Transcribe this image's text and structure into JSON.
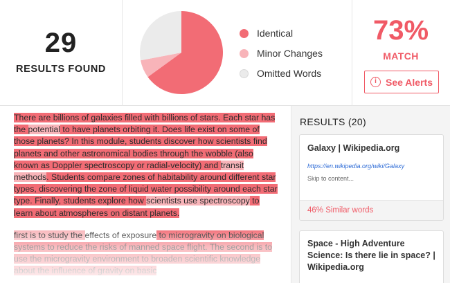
{
  "summary": {
    "results_count": "29",
    "results_label": "RESULTS FOUND",
    "match_percent": "73%",
    "match_label": "MATCH",
    "alerts_button": "See Alerts",
    "info_icon": "i"
  },
  "chart_data": {
    "type": "pie",
    "slices": [
      {
        "label": "Identical",
        "value": 65,
        "color": "#f26c75"
      },
      {
        "label": "Minor Changes",
        "value": 7,
        "color": "#f8b4b9"
      },
      {
        "label": "Omitted Words",
        "value": 28,
        "color": "#ebebeb"
      }
    ]
  },
  "legend": [
    {
      "label": "Identical",
      "color": "#f26c75"
    },
    {
      "label": "Minor Changes",
      "color": "#f8b4b9"
    },
    {
      "label": "Omitted Words",
      "color": "#ebebeb"
    }
  ],
  "document": {
    "paragraph1": [
      {
        "t": "There are billions of galaxies filled with billions of stars. Each star has the ",
        "h": "i"
      },
      {
        "t": "potential",
        "h": "m"
      },
      {
        "t": " to have planets orbiting it. Does life exist on some of those planets? In this module, students discover how scientists find planets and other astronomical bodies through the wobble (also known as Doppler spectroscopy or radial-velocity) and ",
        "h": "i"
      },
      {
        "t": "transit methods",
        "h": "m"
      },
      {
        "t": ". Students compare zones of habitability around different star types, discovering the zone of liquid water possibility around each star type. Finally, students explore how ",
        "h": "i"
      },
      {
        "t": "scientists use spectroscopy",
        "h": "m"
      },
      {
        "t": " to learn about atmospheres on distant planets.",
        "h": "i"
      }
    ],
    "paragraph2": [
      {
        "t": "first is to study the ",
        "h": "m"
      },
      {
        "t": "effects of exposure",
        "h": ""
      },
      {
        "t": " to microgravity on biological systems to reduce the risks of manned space flight. The second is to use the microgravity environment to broaden scientific knowledge about the influence of gravity on basic",
        "h": "i"
      }
    ]
  },
  "results_panel": {
    "title": "RESULTS (20)",
    "cards": [
      {
        "title": "Galaxy | Wikipedia.org",
        "url": "https://en.wikipedia.org/wiki/Galaxy",
        "snippet": "Skip to content...",
        "similarity": "46% Similar words"
      },
      {
        "title": "Space - High Adventure Science: Is there lie in space? | Wikipedia.org"
      }
    ]
  }
}
